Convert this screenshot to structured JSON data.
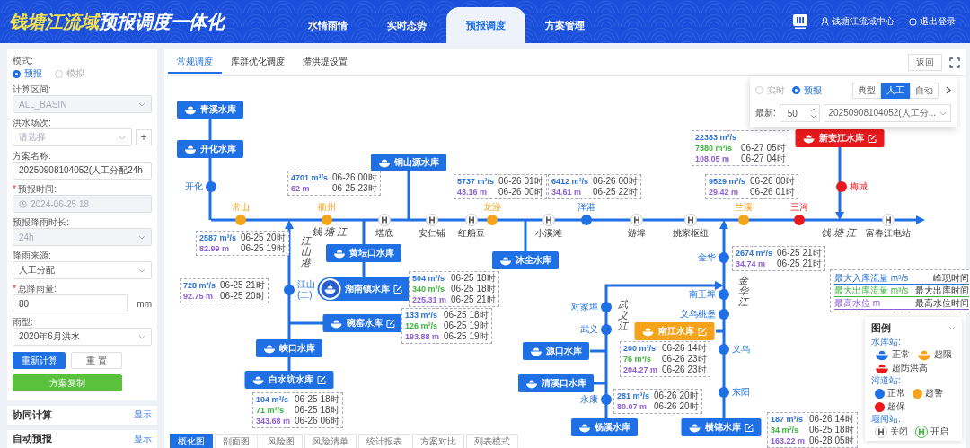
{
  "header": {
    "title_highlight": "钱塘江流域",
    "title": "预报调度一体化",
    "nav": [
      {
        "label": "水情雨情",
        "selected": false
      },
      {
        "label": "实时态势",
        "selected": false
      },
      {
        "label": "预报调度",
        "selected": true
      },
      {
        "label": "方案管理",
        "selected": false
      }
    ],
    "user": "钱塘江流域中心",
    "logout": "退出登录"
  },
  "form": {
    "mode_label": "模式:",
    "modes": [
      {
        "label": "预报",
        "selected": true
      },
      {
        "label": "模拟",
        "selected": false
      }
    ],
    "fields": [
      {
        "kind": "select",
        "label": "计算区间:",
        "value": "ALL_BASIN",
        "disabled": true
      },
      {
        "kind": "select",
        "label": "洪水场次:",
        "placeholder": "请选择",
        "disabled": false,
        "add_button": "+"
      },
      {
        "kind": "input",
        "label": "方案名称:",
        "value": "20250908104052(人工分配24h",
        "disabled": false
      },
      {
        "kind": "date",
        "label": "预报时间:",
        "required_mark": "*",
        "value": "2024-06-25 18",
        "disabled": true
      },
      {
        "kind": "select",
        "label": "预报降雨时长:",
        "value": "24h",
        "disabled": true
      },
      {
        "kind": "select",
        "label": "降雨来源:",
        "value": "人工分配",
        "disabled": false
      },
      {
        "kind": "input",
        "label": "总降雨量:",
        "required_mark": "*",
        "value": "80",
        "unit": "mm",
        "disabled": false
      },
      {
        "kind": "select",
        "label": "雨型:",
        "value": "2020年6月洪水",
        "disabled": false
      }
    ],
    "buttons": [
      {
        "label": "重新计算",
        "kind": "primary"
      },
      {
        "label": "重 置",
        "kind": "default"
      },
      {
        "label": "方案复制",
        "kind": "success"
      }
    ]
  },
  "side_panels": [
    {
      "title": "协同计算",
      "action": "显示"
    },
    {
      "title": "自动预报",
      "action": "显示"
    }
  ],
  "top_tabs": [
    {
      "label": "常规调度",
      "selected": true
    },
    {
      "label": "库群优化调度",
      "selected": false
    },
    {
      "label": "滞洪堤设置",
      "selected": false
    }
  ],
  "return_button": "返回",
  "control_popup": {
    "modes": [
      {
        "label": "实时",
        "selected": false
      },
      {
        "label": "预报",
        "selected": true
      }
    ],
    "segments": [
      {
        "label": "典型",
        "selected": false
      },
      {
        "label": "人工",
        "selected": true
      },
      {
        "label": "自动",
        "selected": false
      }
    ],
    "latest_label": "最新:",
    "latest_value": "50",
    "scheme": "20250908104052(人工分..."
  },
  "diagram": {
    "reservoirs": [
      {
        "name": "青溪水库",
        "color": "#1f6fe5",
        "editable": false,
        "selected": false
      },
      {
        "name": "开化水库",
        "color": "#1f6fe5",
        "editable": false,
        "selected": false
      },
      {
        "name": "铜山源水库",
        "color": "#1f6fe5",
        "editable": false,
        "selected": false
      },
      {
        "name": "黄坛口水库",
        "color": "#1f6fe5",
        "editable": false,
        "selected": false
      },
      {
        "name": "湖南镇水库",
        "color": "#1f6fe5",
        "editable": true,
        "selected": true
      },
      {
        "name": "碗窑水库",
        "color": "#1f6fe5",
        "editable": true,
        "selected": false
      },
      {
        "name": "峡口水库",
        "color": "#1f6fe5",
        "editable": false,
        "selected": false
      },
      {
        "name": "白水坑水库",
        "color": "#1f6fe5",
        "editable": true,
        "selected": false
      },
      {
        "name": "沐尘水库",
        "color": "#1f6fe5",
        "editable": false,
        "selected": false
      },
      {
        "name": "源口水库",
        "color": "#1f6fe5",
        "editable": false,
        "selected": false
      },
      {
        "name": "清溪口水库",
        "color": "#1f6fe5",
        "editable": false,
        "selected": false
      },
      {
        "name": "杨溪水库",
        "color": "#1f6fe5",
        "editable": false,
        "selected": false
      },
      {
        "name": "南江水库",
        "color": "#f5a31a",
        "editable": true,
        "selected": false
      },
      {
        "name": "横锦水库",
        "color": "#1f6fe5",
        "editable": true,
        "selected": false
      },
      {
        "name": "新安江水库",
        "color": "#e8191c",
        "editable": true,
        "selected": false
      }
    ],
    "stations": [
      {
        "name": "开化",
        "kind": "river",
        "color": "#1f6fe5"
      },
      {
        "name": "常山",
        "kind": "river",
        "color": "#f5a31a"
      },
      {
        "name": "衢州",
        "kind": "river",
        "color": "#f5a31a"
      },
      {
        "name": "塔底",
        "kind": "gate",
        "open": false
      },
      {
        "name": "安仁铺",
        "kind": "gate",
        "open": false
      },
      {
        "name": "红船豆",
        "kind": "gate",
        "open": false
      },
      {
        "name": "龙游",
        "kind": "river",
        "color": "#f5a31a"
      },
      {
        "name": "小溪滩",
        "kind": "gate",
        "open": false
      },
      {
        "name": "洋港",
        "kind": "river",
        "color": "#1f6fe5"
      },
      {
        "name": "游埠",
        "kind": "gate",
        "open": false
      },
      {
        "name": "姚家枢纽",
        "kind": "gate",
        "open": false
      },
      {
        "name": "兰溪",
        "kind": "river",
        "color": "#f5a31a"
      },
      {
        "name": "三河",
        "kind": "river",
        "color": "#e8191c"
      },
      {
        "name": "梅城",
        "kind": "river",
        "color": "#e8191c"
      },
      {
        "name": "富春江电站",
        "kind": "gate",
        "open": false
      },
      {
        "name": "江山(二)",
        "kind": "river",
        "color": "#1f6fe5"
      },
      {
        "name": "金华",
        "kind": "river",
        "color": "#1f6fe5"
      },
      {
        "name": "南王埠",
        "kind": "river",
        "color": "#1f6fe5"
      },
      {
        "name": "义乌桃堡",
        "kind": "river",
        "color": "#1f6fe5"
      },
      {
        "name": "义乌",
        "kind": "river",
        "color": "#1f6fe5"
      },
      {
        "name": "东阳",
        "kind": "river",
        "color": "#1f6fe5"
      },
      {
        "name": "对家埠",
        "kind": "river",
        "color": "#1f6fe5"
      },
      {
        "name": "武义",
        "kind": "river",
        "color": "#1f6fe5"
      },
      {
        "name": "永康",
        "kind": "river",
        "color": "#1f6fe5"
      }
    ],
    "rivers": [
      {
        "name": "钱塘江"
      },
      {
        "name": "江山港"
      },
      {
        "name": "钱塘江"
      },
      {
        "name": "金华江"
      },
      {
        "name": "武义江"
      }
    ],
    "data_boxes": [
      {
        "rows": [
          {
            "kind": "inflow",
            "value": "22383 m³/s"
          },
          {
            "kind": "outflow",
            "value": "7380 m³/s",
            "time": "06-27 05时"
          },
          {
            "kind": "level",
            "value": "108.05 m",
            "time": "06-27 04时"
          }
        ]
      },
      {
        "rows": [
          {
            "kind": "inflow",
            "value": "4701 m³/s",
            "time": "06-26 00时"
          },
          {
            "kind": "level",
            "value": "62 m",
            "time": "06-25 23时"
          }
        ]
      },
      {
        "rows": [
          {
            "kind": "inflow",
            "value": "5737 m³/s",
            "time": "06-26 01时"
          },
          {
            "kind": "level",
            "value": "43.16 m",
            "time": "06-26 00时"
          }
        ]
      },
      {
        "rows": [
          {
            "kind": "inflow",
            "value": "6412 m³/s",
            "time": "06-26 00时"
          },
          {
            "kind": "level",
            "value": "34.61 m",
            "time": "06-25 22时"
          }
        ]
      },
      {
        "rows": [
          {
            "kind": "inflow",
            "value": "9529 m³/s",
            "time": "06-26 00时"
          },
          {
            "kind": "level",
            "value": "29.42 m",
            "time": "06-26 01时"
          }
        ]
      },
      {
        "rows": [
          {
            "kind": "inflow",
            "value": "2587 m³/s",
            "time": "06-25 20时"
          },
          {
            "kind": "level",
            "value": "82.99 m",
            "time": "06-25 19时"
          }
        ]
      },
      {
        "rows": [
          {
            "kind": "inflow",
            "value": "2674 m³/s",
            "time": "06-25 21时"
          },
          {
            "kind": "level",
            "value": "34.74 m",
            "time": "06-25 21时"
          }
        ]
      },
      {
        "rows": [
          {
            "kind": "inflow",
            "value": "728 m³/s",
            "time": "06-25 21时"
          },
          {
            "kind": "level",
            "value": "92.75 m",
            "time": "06-25 20时"
          }
        ]
      },
      {
        "rows": [
          {
            "kind": "inflow",
            "value": "504 m³/s",
            "time": "06-25 18时"
          },
          {
            "kind": "outflow",
            "value": "340 m³/s",
            "time": "06-25 18时"
          },
          {
            "kind": "level",
            "value": "225.31 m",
            "time": "06-25 21时"
          }
        ]
      },
      {
        "rows": [
          {
            "kind": "inflow",
            "value": "133 m³/s",
            "time": "06-25 18时"
          },
          {
            "kind": "outflow",
            "value": "126 m³/s",
            "time": "06-25 19时"
          },
          {
            "kind": "level",
            "value": "193.88 m",
            "time": "06-25 19时"
          }
        ]
      },
      {
        "rows": [
          {
            "kind": "inflow",
            "value": "200 m³/s",
            "time": "06-26 14时"
          },
          {
            "kind": "outflow",
            "value": "76 m³/s",
            "time": "06-26 23时"
          },
          {
            "kind": "level",
            "value": "204.27 m",
            "time": "06-26 23时"
          }
        ]
      },
      {
        "rows": [
          {
            "kind": "inflow",
            "value": "104 m³/s",
            "time": "06-25 18时"
          },
          {
            "kind": "outflow",
            "value": "71 m³/s",
            "time": "06-25 18时"
          },
          {
            "kind": "level",
            "value": "343.68 m",
            "time": "06-26 06时"
          }
        ]
      },
      {
        "rows": [
          {
            "kind": "inflow",
            "value": "281 m³/s",
            "time": "06-26 20时"
          },
          {
            "kind": "level",
            "value": "80.07 m",
            "time": "06-26 20时"
          }
        ]
      },
      {
        "rows": [
          {
            "kind": "inflow",
            "value": "187 m³/s",
            "time": "06-26 14时"
          },
          {
            "kind": "outflow",
            "value": "34 m³/s",
            "time": "06-25 18时"
          },
          {
            "kind": "level",
            "value": "163.22 m",
            "time": "06-28 05时"
          }
        ]
      }
    ]
  },
  "data_legend": [
    {
      "kind": "inflow",
      "label": "最大入库流量 m³/s",
      "time_label": "峰现时间"
    },
    {
      "kind": "outflow",
      "label": "最大出库流量 m³/s",
      "time_label": "最大出库时间"
    },
    {
      "kind": "level",
      "label": "最高水位 m",
      "time_label": "最高水位时间"
    }
  ],
  "legend": {
    "title": "图例",
    "groups": [
      {
        "title": "水库站:",
        "items": [
          {
            "kind": "reservoir",
            "color": "#1f6fe5",
            "label": "正常"
          },
          {
            "kind": "reservoir",
            "color": "#f5a31a",
            "label": "超限"
          },
          {
            "kind": "reservoir",
            "color": "#e8191c",
            "label": "超防洪高"
          }
        ]
      },
      {
        "title": "河道站:",
        "items": [
          {
            "kind": "river",
            "color": "#1f6fe5",
            "label": "正常"
          },
          {
            "kind": "river",
            "color": "#f5a31a",
            "label": "超警"
          },
          {
            "kind": "river",
            "color": "#e8191c",
            "label": "超保"
          }
        ]
      },
      {
        "title": "堰闸站:",
        "items": [
          {
            "kind": "gate",
            "open": false,
            "label": "关闭"
          },
          {
            "kind": "gate",
            "open": true,
            "label": "开启"
          }
        ]
      }
    ]
  },
  "bottom_tabs": [
    {
      "label": "概化图",
      "selected": true
    },
    {
      "label": "剖面图",
      "selected": false
    },
    {
      "label": "风险图",
      "selected": false
    },
    {
      "label": "风险清单",
      "selected": false
    },
    {
      "label": "统计报表",
      "selected": false
    },
    {
      "label": "方案对比",
      "selected": false
    },
    {
      "label": "列表模式",
      "selected": false
    }
  ]
}
